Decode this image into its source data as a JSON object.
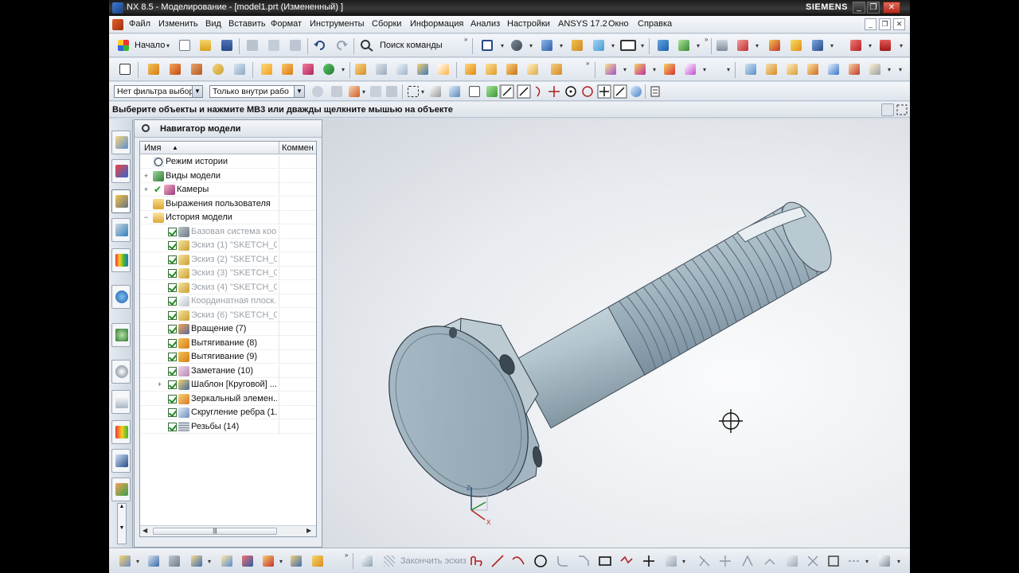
{
  "window": {
    "title": "NX 8.5 - Моделирование - [model1.prt (Измененный) ]",
    "brand": "SIEMENS",
    "controls": [
      "_",
      "❐",
      "✕"
    ]
  },
  "menubar": {
    "items": [
      "Файл",
      "Изменить",
      "Вид",
      "Вставить",
      "Формат",
      "Инструменты",
      "Сборки",
      "Информация",
      "Анализ",
      "Настройки",
      "ANSYS 17.2",
      "Окно",
      "Справка"
    ]
  },
  "standard_toolbar": {
    "start_label": "Начало",
    "command_finder_label": "Поиск команды"
  },
  "selection_bar": {
    "type_filter": "Нет фильтра выбор",
    "scope": "Только внутри рабо"
  },
  "cue_line": {
    "message": "Выберите объекты и нажмите MB3 или дважды щелкните мышью на объекте"
  },
  "navigator": {
    "title": "Навигатор модели",
    "columns": {
      "name": "Имя",
      "comment": "Коммен"
    },
    "top_nodes": [
      {
        "label": "Режим истории",
        "icon": "clock-icon",
        "expander": ""
      },
      {
        "label": "Виды модели",
        "icon": "model-views-icon",
        "expander": "+"
      },
      {
        "label": "Камеры",
        "icon": "camera-icon",
        "expander": "+"
      },
      {
        "label": "Выражения пользователя",
        "icon": "folder-icon",
        "expander": ""
      },
      {
        "label": "История модели",
        "icon": "folder-open-icon",
        "expander": "−"
      }
    ],
    "history": [
      {
        "label": "Базовая система коо...",
        "icon": "datum-csys-icon",
        "dim": true
      },
      {
        "label": "Эскиз (1) \"SKETCH_0...",
        "icon": "sketch-icon",
        "dim": true
      },
      {
        "label": "Эскиз (2) \"SKETCH_0...",
        "icon": "sketch-icon",
        "dim": true
      },
      {
        "label": "Эскиз (3) \"SKETCH_0...",
        "icon": "sketch-icon",
        "dim": true
      },
      {
        "label": "Эскиз (4) \"SKETCH_0...",
        "icon": "sketch-icon",
        "dim": true
      },
      {
        "label": "Координатная плоск...",
        "icon": "datum-plane-icon",
        "dim": true
      },
      {
        "label": "Эскиз (6) \"SKETCH_0...",
        "icon": "sketch-icon",
        "dim": true
      },
      {
        "label": "Вращение (7)",
        "icon": "revolve-icon",
        "dim": false
      },
      {
        "label": "Вытягивание (8)",
        "icon": "extrude-icon",
        "dim": false
      },
      {
        "label": "Вытягивание (9)",
        "icon": "extrude-icon",
        "dim": false
      },
      {
        "label": "Заметание (10)",
        "icon": "sweep-icon",
        "dim": false
      },
      {
        "label": "Шаблон [Круговой] ...",
        "icon": "pattern-icon",
        "dim": false
      },
      {
        "label": "Зеркальный элемен...",
        "icon": "mirror-icon",
        "dim": false
      },
      {
        "label": "Скругление ребра (1...",
        "icon": "edge-blend-icon",
        "dim": false
      },
      {
        "label": "Резьбы (14)",
        "icon": "thread-icon",
        "dim": false
      }
    ]
  },
  "triad": {
    "z": "Z",
    "x": "X"
  },
  "bottom_toolbar": {
    "finish_sketch_label": "Закончить эскиз"
  },
  "colors": {
    "part_face": "#a9bcc7",
    "part_dark": "#7f939f",
    "part_light": "#d3dee4",
    "background_light": "#f5f6f8",
    "background_dark": "#cfd5dc"
  }
}
